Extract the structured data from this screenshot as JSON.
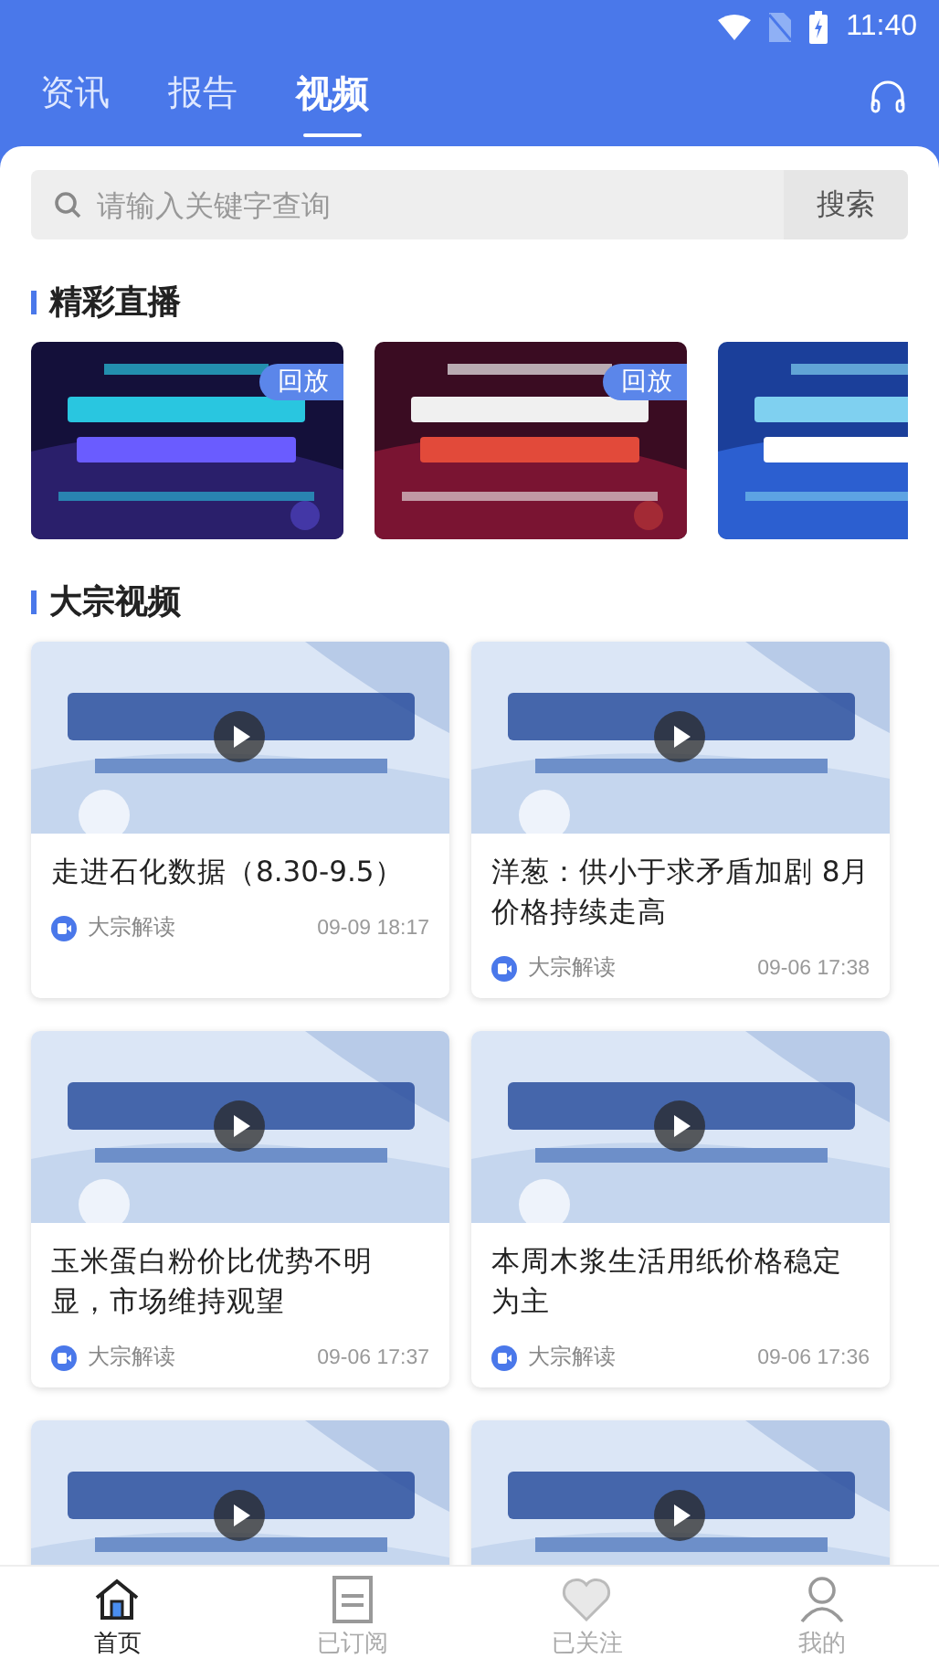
{
  "status_bar": {
    "time": "11:40"
  },
  "tabs": [
    {
      "label": "资讯",
      "selected": false
    },
    {
      "label": "报告",
      "selected": false
    },
    {
      "label": "视频",
      "selected": true
    }
  ],
  "search": {
    "placeholder": "请输入关键字查询",
    "button": "搜索"
  },
  "live_section": {
    "title": "精彩直播",
    "items": [
      {
        "kind": "picture",
        "badge": "回放"
      },
      {
        "kind": "picture",
        "badge": "回放"
      },
      {
        "kind": "picture"
      }
    ]
  },
  "video_section": {
    "title": "大宗视频",
    "items": [
      {
        "kind": "card",
        "title": "走进石化数据（8.30-9.5）",
        "source": "大宗解读",
        "time": "09-09 18:17"
      },
      {
        "kind": "card",
        "title": "洋葱：供小于求矛盾加剧 8月价格持续走高",
        "source": "大宗解读",
        "time": "09-06 17:38"
      },
      {
        "kind": "card",
        "title": "玉米蛋白粉价比优势不明显，市场维持观望",
        "source": "大宗解读",
        "time": "09-06 17:37"
      },
      {
        "kind": "card",
        "title": "本周木浆生活用纸价格稳定为主",
        "source": "大宗解读",
        "time": "09-06 17:36"
      },
      {
        "kind": "picture"
      },
      {
        "kind": "picture"
      }
    ]
  },
  "bottom_nav": [
    {
      "label": "首页",
      "selected": true
    },
    {
      "label": "已订阅",
      "selected": false
    },
    {
      "label": "已关注",
      "selected": false
    },
    {
      "label": "我的",
      "selected": false
    }
  ]
}
